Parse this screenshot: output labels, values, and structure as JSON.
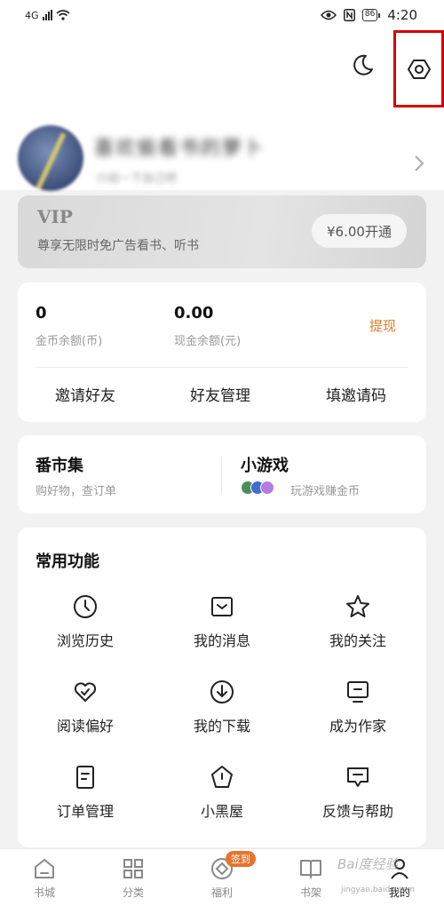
{
  "status_bar": {
    "network": "4G",
    "battery": "86",
    "time": "4:20"
  },
  "profile": {
    "name": "喜欢偷看书的萝卜",
    "subtitle": "介绍一下自己吧"
  },
  "vip": {
    "title": "VIP",
    "desc": "尊享无限时免广告看书、听书",
    "button": "¥6.00开通"
  },
  "balance": {
    "coins_value": "0",
    "coins_label": "金币余额(币)",
    "cash_value": "0.00",
    "cash_label": "现金余额(元)",
    "withdraw": "提现"
  },
  "friends": {
    "invite": "邀请好友",
    "manage": "好友管理",
    "code": "填邀请码"
  },
  "market": {
    "title": "番市集",
    "subtitle": "购好物，查订单"
  },
  "games": {
    "title": "小游戏",
    "subtitle": "玩游戏赚金币"
  },
  "functions": {
    "title": "常用功能",
    "items": [
      {
        "label": "浏览历史",
        "icon": "clock-icon"
      },
      {
        "label": "我的消息",
        "icon": "inbox-icon"
      },
      {
        "label": "我的关注",
        "icon": "star-icon"
      },
      {
        "label": "阅读偏好",
        "icon": "heart-icon"
      },
      {
        "label": "我的下载",
        "icon": "download-icon"
      },
      {
        "label": "成为作家",
        "icon": "monitor-icon"
      },
      {
        "label": "订单管理",
        "icon": "order-icon"
      },
      {
        "label": "小黑屋",
        "icon": "pentagon-icon"
      },
      {
        "label": "反馈与帮助",
        "icon": "feedback-icon"
      }
    ]
  },
  "tabs": [
    {
      "label": "书城",
      "icon": "home-icon"
    },
    {
      "label": "分类",
      "icon": "grid-icon"
    },
    {
      "label": "福利",
      "icon": "gift-icon",
      "badge": "签到"
    },
    {
      "label": "书架",
      "icon": "book-icon"
    },
    {
      "label": "我的",
      "icon": "user-icon"
    }
  ],
  "watermark": {
    "text": "Bai度经验",
    "sub": "jingyan.baidu.com"
  },
  "colors": {
    "accent": "#e07b20",
    "highlight_box": "#d40000",
    "badge": "#e8732e"
  }
}
